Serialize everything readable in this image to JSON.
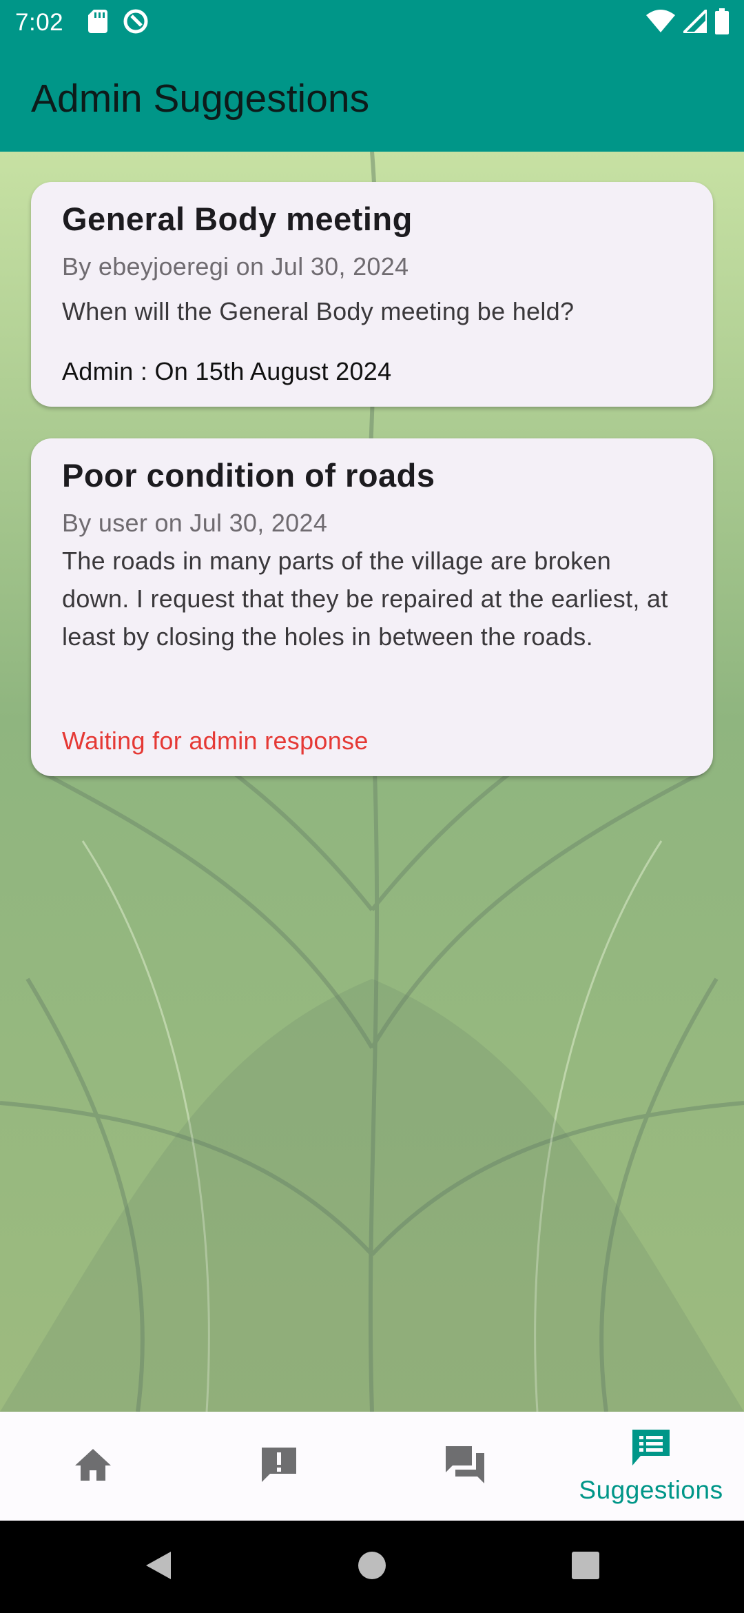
{
  "status_bar": {
    "time": "7:02"
  },
  "app_bar": {
    "title": "Admin Suggestions"
  },
  "suggestions": [
    {
      "title": "General Body meeting",
      "meta": "By ebeyjoeregi on Jul 30, 2024",
      "body": "When will the General Body meeting be held?",
      "response": "Admin : On 15th August 2024"
    },
    {
      "title": "Poor condition of roads",
      "meta": "By user on Jul 30, 2024",
      "body": "The roads in many parts of the village are broken down. I request that they be repaired at the earliest, at least by closing the holes in between the roads.",
      "response": "Waiting for admin response"
    }
  ],
  "bottom_nav": {
    "items": [
      {
        "icon": "home-icon"
      },
      {
        "icon": "report-icon"
      },
      {
        "icon": "forum-icon"
      },
      {
        "icon": "suggestions-icon",
        "label": "Suggestions"
      }
    ],
    "active_index": 3
  },
  "colors": {
    "primary": "#009688",
    "card": "#f4f0f7",
    "waiting": "#e53935"
  }
}
